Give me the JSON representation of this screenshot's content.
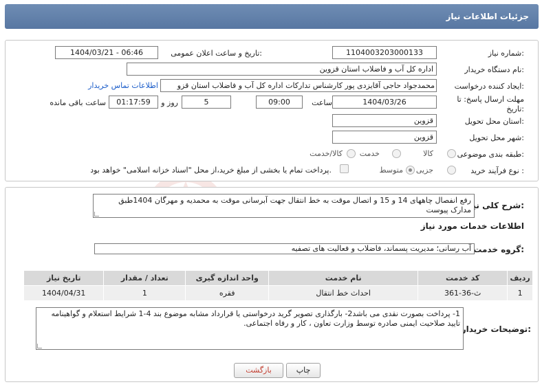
{
  "header": {
    "title": "جزئیات اطلاعات نیاز"
  },
  "form": {
    "need_number_label": "شماره نیاز:",
    "need_number": "1104003203000133",
    "announce_label": "تاریخ و ساعت اعلان عمومی:",
    "announce_value": "1404/03/21 - 06:46",
    "buyer_org_label": "نام دستگاه خریدار:",
    "buyer_org": "اداره کل آب و فاضلاب استان قزوین",
    "creator_label": "ایجاد کننده درخواست:",
    "creator": "محمدجواد حاجی آقایزدی پور کارشناس تدارکات اداره کل آب و فاضلاب استان قزو",
    "contact_link": "اطلاعات تماس خریدار",
    "deadline_label": "مهلت ارسال پاسخ: تا تاریخ:",
    "deadline_date": "1404/03/26",
    "time_label": "ساعت",
    "deadline_time": "09:00",
    "days_value": "5",
    "days_label": "روز و",
    "remaining_time": "01:17:59",
    "remaining_label": "ساعت باقی مانده",
    "province_label": "استان محل تحویل:",
    "province": "قزوین",
    "city_label": "شهر محل تحویل:",
    "city": "قزوین",
    "category_label": "طبقه بندی موضوعی:",
    "category_options": [
      "کالا",
      "خدمت",
      "کالا/خدمت"
    ],
    "process_label": "نوع فرآیند خرید :",
    "process_options": [
      "جزیی",
      "متوسط"
    ],
    "payment_note": "پرداخت تمام یا بخشی از مبلغ خرید،از محل \"اسناد خزانه اسلامی\" خواهد بود."
  },
  "summary": {
    "label": "شرح کلی نیاز:",
    "text": "رفع انفصال  چاههای 14 و 15 و اتصال موقت به خط انتقال جهت آبرسانی موقت به محمدیه و مهرگان 1404طبق مدارک پیوست"
  },
  "services": {
    "section_title": "اطلاعات خدمات مورد نیاز",
    "group_label": "گروه خدمت:",
    "group_value": "آب رسانی؛ مدیریت پسماند، فاضلاب و فعالیت های تصفیه",
    "columns": [
      "ردیف",
      "کد خدمت",
      "نام خدمت",
      "واحد اندازه گیری",
      "تعداد / مقدار",
      "تاریخ نیاز"
    ],
    "rows": [
      {
        "row": "1",
        "code": "ث-36-361",
        "name": "احداث خط انتقال",
        "unit": "فقره",
        "qty": "1",
        "date": "1404/04/31"
      }
    ]
  },
  "notes": {
    "label": "توضیحات خریدار:",
    "text": "1- پرداخت بصورت نقدی می باشد2- بارگذاری تصویر گرید درخواستی یا قرارداد مشابه موضوع بند 4-1 شرایط استعلام و گواهینامه تایید صلاحیت ایمنی صادره توسط وزارت تعاون ، کار و رفاه اجتماعی."
  },
  "buttons": {
    "print": "چاپ",
    "back": "بازگشت"
  },
  "colors": {
    "header": "#5f7fa9",
    "link": "#1a5cc9",
    "back_text": "#c0392b"
  }
}
